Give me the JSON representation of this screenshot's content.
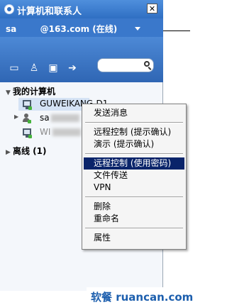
{
  "window": {
    "title": "计算机和联系人",
    "close": "✕"
  },
  "account": {
    "text": "sa        @163.com (在线)"
  },
  "toolbar": {
    "icons": [
      "add-computer-icon",
      "add-contact-icon",
      "connect-computer-icon",
      "forward-arrow-icon"
    ],
    "search_placeholder": ""
  },
  "groups": [
    {
      "label": "我的计算机",
      "expanded": true
    },
    {
      "label": "离线 (1)",
      "expanded": false
    }
  ],
  "contacts": [
    {
      "name": "GUWEIKANG-D1",
      "icon": "computer-icon",
      "selected": true
    },
    {
      "name": "sa",
      "icon": "person-icon",
      "selected": false
    },
    {
      "name": "WI",
      "icon": "computer-icon",
      "selected": false
    }
  ],
  "context_menu": {
    "items": [
      {
        "label": "发送消息"
      },
      {
        "label": "远程控制 (提示确认)"
      },
      {
        "label": "演示 (提示确认)"
      },
      {
        "label": "远程控制 (使用密码)",
        "highlighted": true
      },
      {
        "label": "文件传送"
      },
      {
        "label": "VPN"
      },
      {
        "label": "删除"
      },
      {
        "label": "重命名"
      },
      {
        "label": "属性"
      }
    ]
  },
  "watermark": {
    "text": "软餐 ruancan.com"
  }
}
